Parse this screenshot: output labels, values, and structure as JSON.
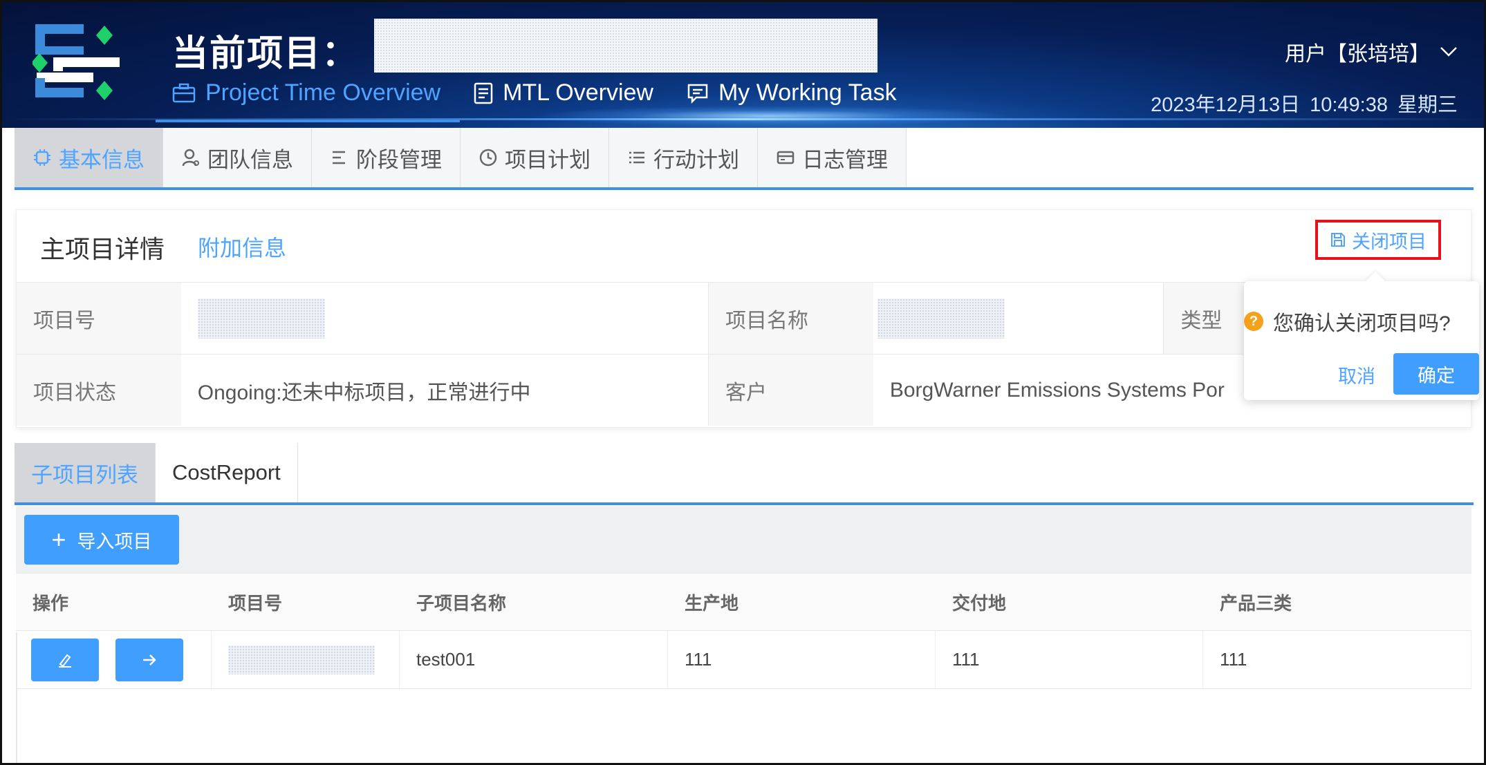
{
  "header": {
    "title": "当前项目：",
    "nav": [
      {
        "label": "Project Time Overview",
        "icon": "briefcase-icon"
      },
      {
        "label": "MTL Overview",
        "icon": "document-icon"
      },
      {
        "label": "My Working Task",
        "icon": "chat-icon"
      }
    ],
    "user": "用户【张培培】",
    "date": "2023年12月13日",
    "time": "10:49:38",
    "weekday": "星期三",
    "colors": {
      "accent": "#409eff",
      "header_bg": "#061e55",
      "highlight": "#e8101a"
    }
  },
  "tabs": [
    {
      "label": "基本信息",
      "icon": "chip-icon"
    },
    {
      "label": "团队信息",
      "icon": "user-icon"
    },
    {
      "label": "阶段管理",
      "icon": "stage-icon"
    },
    {
      "label": "项目计划",
      "icon": "clock-icon"
    },
    {
      "label": "行动计划",
      "icon": "list-icon"
    },
    {
      "label": "日志管理",
      "icon": "card-icon"
    }
  ],
  "detail": {
    "title": "主项目详情",
    "subtitle": "附加信息",
    "close_button": "关闭项目",
    "fields": {
      "project_no_label": "项目号",
      "project_name_label": "项目名称",
      "type_label": "类型",
      "status_label": "项目状态",
      "status_value": "Ongoing:还未中标项目，正常进行中",
      "customer_label": "客户",
      "customer_value": "BorgWarner Emissions Systems Por"
    }
  },
  "popover": {
    "message": "您确认关闭项目吗?",
    "cancel": "取消",
    "confirm": "确定"
  },
  "subtabs": [
    {
      "label": "子项目列表"
    },
    {
      "label": "CostReport"
    }
  ],
  "toolbar": {
    "import_label": "导入项目"
  },
  "table": {
    "headers": [
      "操作",
      "项目号",
      "子项目名称",
      "生产地",
      "交付地",
      "产品三类"
    ],
    "rows": [
      {
        "name": "test001",
        "production": "111",
        "delivery": "111",
        "category": "111"
      }
    ]
  }
}
